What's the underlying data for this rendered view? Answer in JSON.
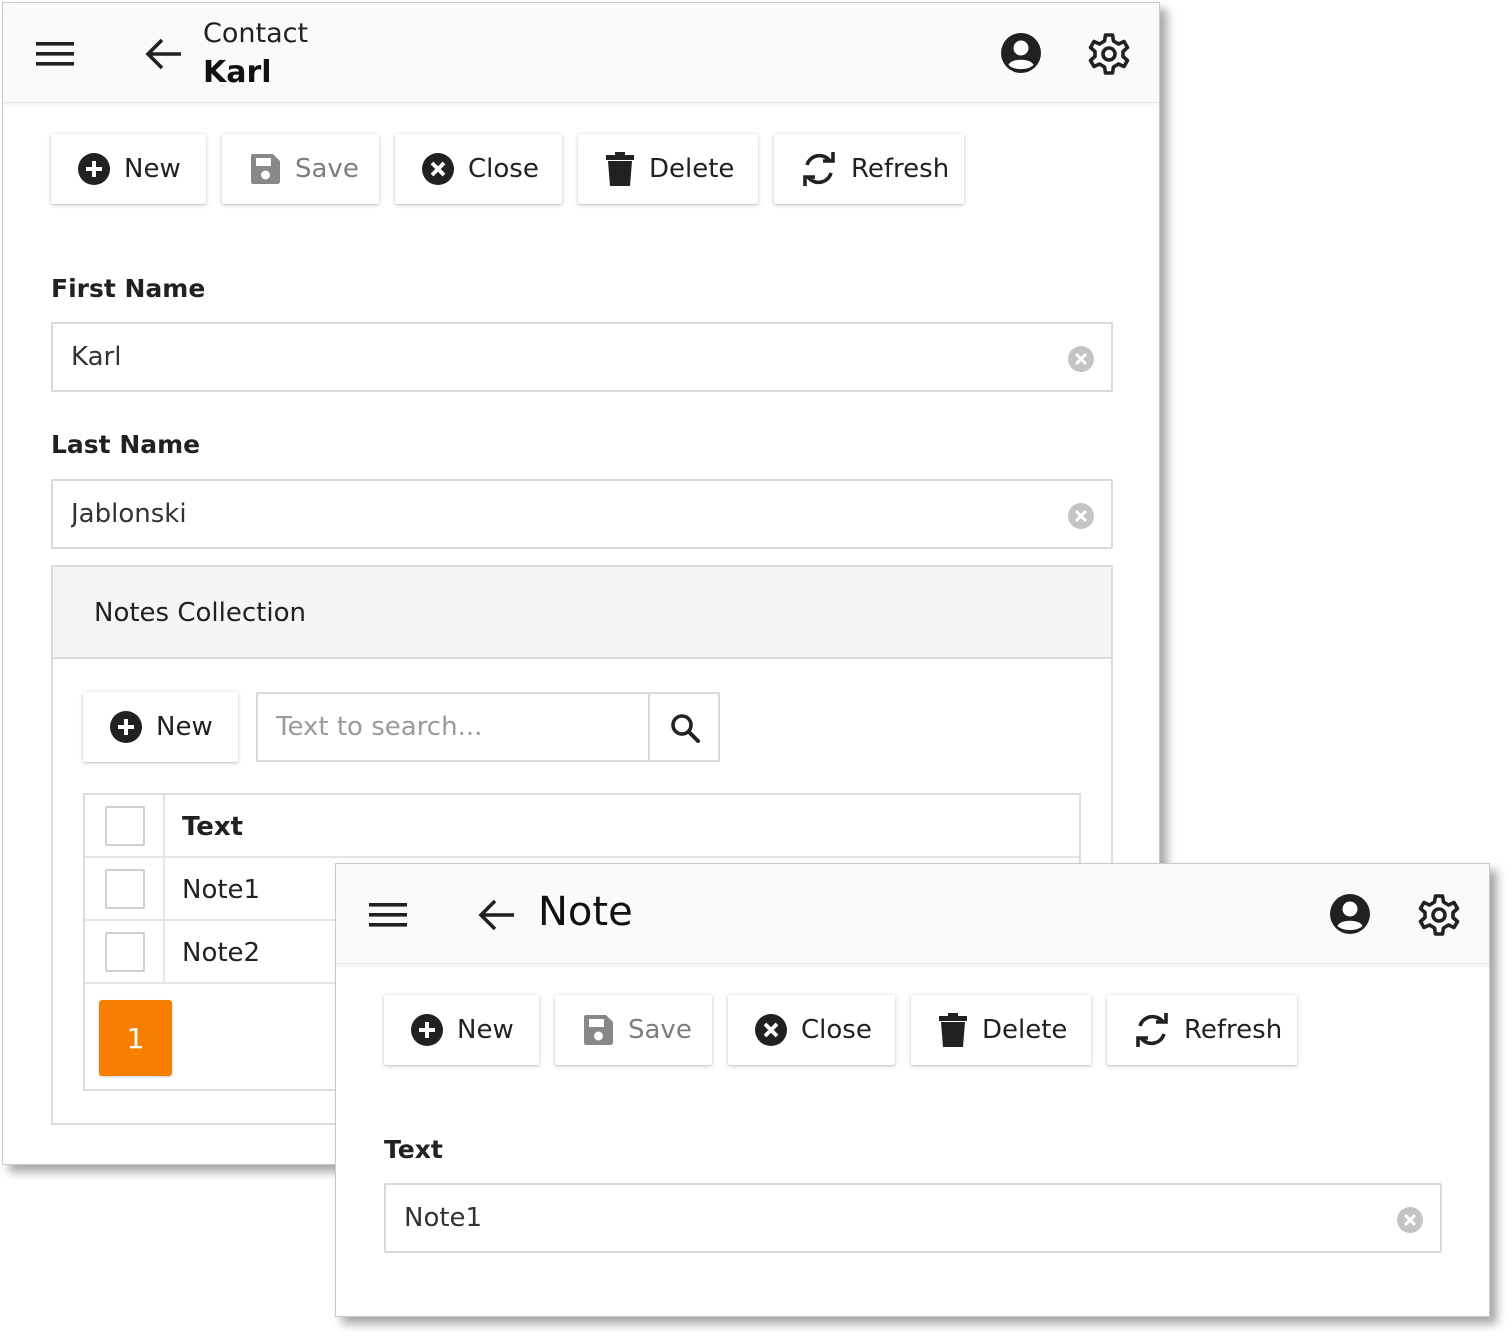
{
  "contact_window": {
    "header": {
      "subtitle": "Contact",
      "title": "Karl"
    },
    "toolbar": {
      "new": "New",
      "save": "Save",
      "close": "Close",
      "delete": "Delete",
      "refresh": "Refresh"
    },
    "first_name": {
      "label": "First Name",
      "value": "Karl"
    },
    "last_name": {
      "label": "Last Name",
      "value": "Jablonski"
    },
    "notes": {
      "title": "Notes Collection",
      "new": "New",
      "search_placeholder": "Text to search...",
      "grid": {
        "column": "Text",
        "rows": [
          {
            "text": "Note1"
          },
          {
            "text": "Note2"
          }
        ]
      },
      "page": "1"
    }
  },
  "note_window": {
    "header": {
      "title": "Note"
    },
    "toolbar": {
      "new": "New",
      "save": "Save",
      "close": "Close",
      "delete": "Delete",
      "refresh": "Refresh"
    },
    "text_field": {
      "label": "Text",
      "value": "Note1"
    }
  },
  "colors": {
    "accent": "#f77f00",
    "disabled_text": "#7d7d7d",
    "icon": "#212121"
  }
}
